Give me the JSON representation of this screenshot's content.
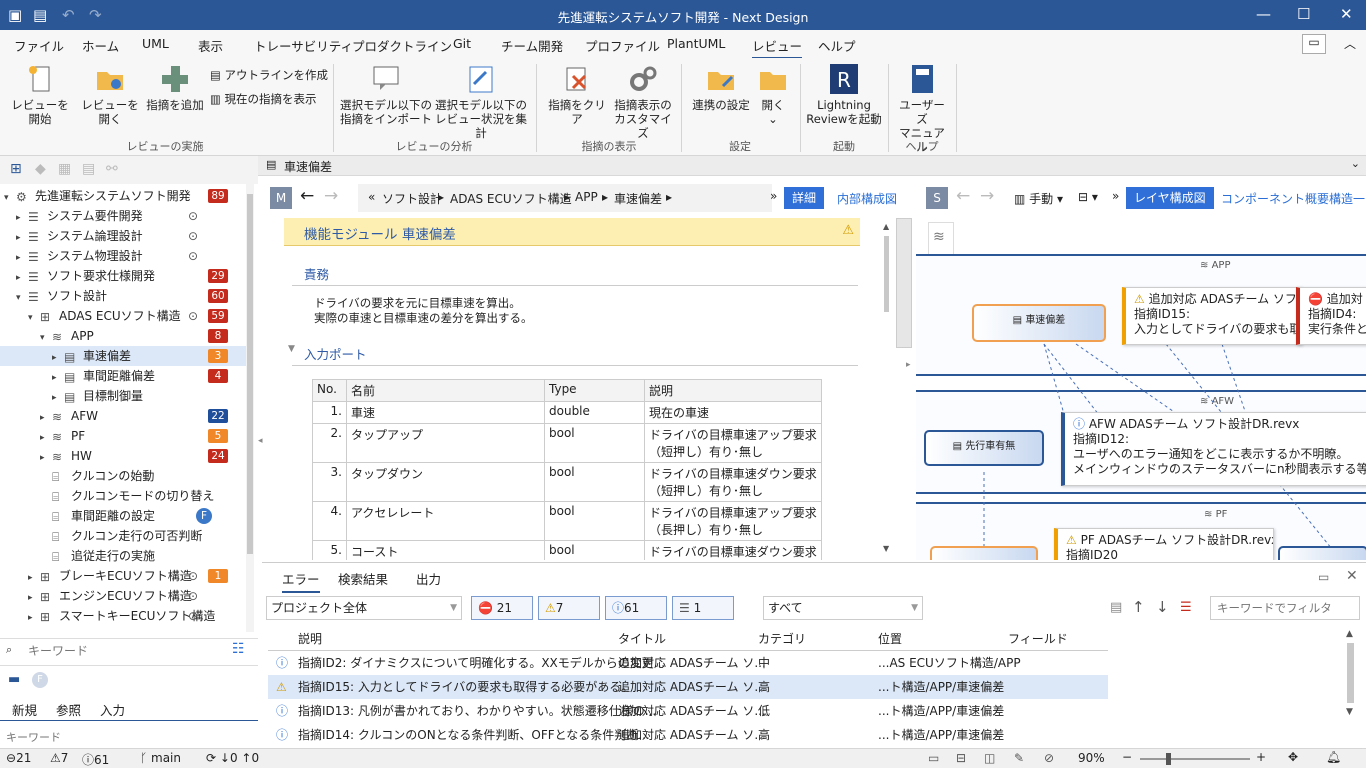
{
  "window": {
    "title": "先進運転システムソフト開発 - Next Design"
  },
  "menu": [
    "ファイル",
    "ホーム",
    "UML",
    "表示",
    "トレーサビリティ",
    "プロダクトライン",
    "Git",
    "チーム開発",
    "プロファイル",
    "PlantUML",
    "レビュー",
    "ヘルプ"
  ],
  "ribbon": {
    "start_review": "レビューを開始",
    "open_review": "レビューを開く",
    "add_issue": "指摘を追加",
    "create_outline": "アウトラインを作成",
    "show_current": "現在の指摘を表示",
    "group1": "レビューの実施",
    "import_issues": [
      "選択モデル以下の",
      "指摘をインポート"
    ],
    "summary": [
      "選択モデル以下の",
      "レビュー状況を集計"
    ],
    "group2": "レビューの分析",
    "clear_issues": "指摘をクリア",
    "customize": [
      "指摘表示の",
      "カスタマイズ"
    ],
    "group3": "指摘の表示",
    "link_settings": "連携の設定",
    "open": "開く",
    "group4": "設定",
    "lightning": [
      "Lightning",
      "Reviewを起動"
    ],
    "group5": "起動",
    "manual": [
      "ユーザーズ",
      "マニュアル"
    ],
    "group6": "ヘルプ"
  },
  "tree": [
    {
      "label": "先進運転システムソフト開発",
      "badge": "89",
      "color": "red"
    },
    {
      "label": "システム要件開発"
    },
    {
      "label": "システム論理設計"
    },
    {
      "label": "システム物理設計"
    },
    {
      "label": "ソフト要求仕様開発",
      "badge": "29",
      "color": "red"
    },
    {
      "label": "ソフト設計",
      "badge": "60",
      "color": "red"
    },
    {
      "label": "ADAS ECUソフト構造",
      "badge": "59",
      "color": "red"
    },
    {
      "label": "APP",
      "badge": "8",
      "color": "red"
    },
    {
      "label": "車速偏差",
      "badge": "3",
      "color": "orange"
    },
    {
      "label": "車間距離偏差",
      "badge": "4",
      "color": "red"
    },
    {
      "label": "目標制御量"
    },
    {
      "label": "AFW",
      "badge": "22",
      "color": "blue"
    },
    {
      "label": "PF",
      "badge": "5",
      "color": "orange"
    },
    {
      "label": "HW",
      "badge": "24",
      "color": "red"
    },
    {
      "label": "クルコンの始動"
    },
    {
      "label": "クルコンモードの切り替え"
    },
    {
      "label": "車間距離の設定",
      "badge": "F",
      "color": "circle"
    },
    {
      "label": "クルコン走行の可否判断"
    },
    {
      "label": "追従走行の実施"
    },
    {
      "label": "ブレーキECUソフト構造",
      "badge": "1",
      "color": "orange"
    },
    {
      "label": "エンジンECUソフト構造"
    },
    {
      "label": "スマートキーECUソフト構造"
    }
  ],
  "left_search": {
    "placeholder": "キーワード"
  },
  "left_tabs": [
    "新規",
    "参照",
    "入力"
  ],
  "left_search2": {
    "placeholder": "キーワード"
  },
  "doc_tab": "車速偏差",
  "editor": {
    "breadcrumb": [
      "ソフト設計",
      "ADAS ECUソフト構造",
      "APP",
      "車速偏差"
    ],
    "detail": "詳細",
    "internal": "内部構成図",
    "header": "機能モジュール 車速偏差",
    "resp_title": "責務",
    "resp_text": [
      "ドライバの要求を元に目標車速を算出。",
      "実際の車速と目標車速の差分を算出する。"
    ],
    "input_title": "入力ポート",
    "columns": [
      "No.",
      "名前",
      "Type",
      "説明"
    ],
    "rows": [
      {
        "no": "1.",
        "name": "車速",
        "type": "double",
        "desc": "現在の車速"
      },
      {
        "no": "2.",
        "name": "タップアップ",
        "type": "bool",
        "desc": "ドライバの目標車速アップ要求（短押し）有り･無し"
      },
      {
        "no": "3.",
        "name": "タップダウン",
        "type": "bool",
        "desc": "ドライバの目標車速ダウン要求（短押し）有り･無し"
      },
      {
        "no": "4.",
        "name": "アクセレレート",
        "type": "bool",
        "desc": "ドライバの目標車速アップ要求（長押し）有り･無し"
      },
      {
        "no": "5.",
        "name": "コースト",
        "type": "bool",
        "desc": "ドライバの目標車速ダウン要求"
      }
    ]
  },
  "diagram": {
    "manual": "手動",
    "layer_view": "レイヤ構成図",
    "comp_overview": "コンポーネント概要",
    "more": "構造一",
    "layers": [
      "APP",
      "AFW",
      "PF"
    ],
    "nodes": [
      "車速偏差",
      "先行車有無"
    ],
    "cards": [
      {
        "title": "追加対応 ADASチーム ソフ",
        "id": "指摘ID15:",
        "text": "入力としてドライバの要求も取得す"
      },
      {
        "title": "追加対",
        "id": "指摘ID4:",
        "text": "実行条件と"
      },
      {
        "title": "AFW ADASチーム ソフト設計DR.revx",
        "id": "指摘ID12:",
        "text": "ユーザへのエラー通知をどこに表示するか不明瞭。",
        "text2": "メインウィンドウのステータスバーにn秒間表示する等の記述がほし"
      },
      {
        "title": "PF ADASチーム ソフト設計DR.revx",
        "id": "指摘ID20",
        "text": ""
      }
    ]
  },
  "bottom": {
    "tabs": [
      "エラー",
      "検索結果",
      "出力"
    ],
    "scope": "プロジェクト全体",
    "counts": {
      "error": "21",
      "warning": "7",
      "info": "61",
      "other": "1"
    },
    "filter": "すべて",
    "filter_placeholder": "キーワードでフィルタ",
    "columns": [
      "説明",
      "タイトル",
      "カテゴリ",
      "位置",
      "フィールド"
    ],
    "rows": [
      {
        "desc": "指摘ID2: ダイナミクスについて明確化する。XXモデルからの変更...",
        "title": "追加対応 ADASチーム ソ...",
        "cat": "中",
        "pos": "...AS ECUソフト構造/APP",
        "kind": "info"
      },
      {
        "desc": "指摘ID15: 入力としてドライバの要求も取得する必要がある。",
        "title": "追加対応 ADASチーム ソ...",
        "cat": "高",
        "pos": "...ト構造/APP/車速偏差",
        "kind": "warn"
      },
      {
        "desc": "指摘ID13: 凡例が書かれており、わかりやすい。状態遷移仕様の...",
        "title": "追加対応 ADASチーム ソ...",
        "cat": "低",
        "pos": "...ト構造/APP/車速偏差",
        "kind": "info"
      },
      {
        "desc": "指摘ID14: クルコンのONとなる条件判断、OFFとなる条件判断...",
        "title": "追加対応 ADASチーム ソ...",
        "cat": "高",
        "pos": "...ト構造/APP/車速偏差",
        "kind": "info"
      }
    ]
  },
  "status": {
    "errors": "21",
    "warnings": "7",
    "infos": "61",
    "branch": "main",
    "down": "0",
    "up": "0",
    "zoom": "90%"
  }
}
